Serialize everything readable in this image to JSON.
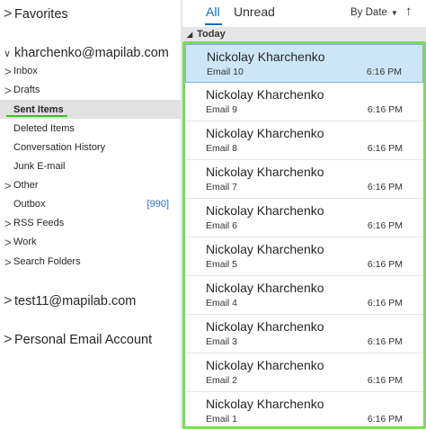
{
  "folders": {
    "favorites_label": "Favorites",
    "accounts": [
      {
        "name": "kharchenko@mapilab.com",
        "items": [
          {
            "label": "Inbox",
            "has_chevron": true
          },
          {
            "label": "Drafts",
            "has_chevron": true
          },
          {
            "label": "Sent Items",
            "has_chevron": false,
            "selected": true
          },
          {
            "label": "Deleted Items",
            "has_chevron": false
          },
          {
            "label": "Conversation History",
            "has_chevron": false
          },
          {
            "label": "Junk E-mail",
            "has_chevron": false
          },
          {
            "label": "Other",
            "has_chevron": true
          },
          {
            "label": "Outbox",
            "has_chevron": false,
            "count": "[990]"
          },
          {
            "label": "RSS Feeds",
            "has_chevron": true
          },
          {
            "label": "Work",
            "has_chevron": true
          },
          {
            "label": "Search Folders",
            "has_chevron": true
          }
        ]
      },
      {
        "name": "test11@mapilab.com"
      },
      {
        "name": "Personal Email Account"
      }
    ]
  },
  "list": {
    "tabs": {
      "all": "All",
      "unread": "Unread"
    },
    "sort_label": "By Date",
    "sort_direction_icon": "↑",
    "group_label": "Today",
    "messages": [
      {
        "sender": "Nickolay Kharchenko",
        "subject": "Email 10",
        "time": "6:16 PM"
      },
      {
        "sender": "Nickolay Kharchenko",
        "subject": "Email 9",
        "time": "6:16 PM"
      },
      {
        "sender": "Nickolay Kharchenko",
        "subject": "Email 8",
        "time": "6:16 PM"
      },
      {
        "sender": "Nickolay Kharchenko",
        "subject": "Email 7",
        "time": "6:16 PM"
      },
      {
        "sender": "Nickolay Kharchenko",
        "subject": "Email 6",
        "time": "6:16 PM"
      },
      {
        "sender": "Nickolay Kharchenko",
        "subject": "Email 5",
        "time": "6:16 PM"
      },
      {
        "sender": "Nickolay Kharchenko",
        "subject": "Email 4",
        "time": "6:16 PM"
      },
      {
        "sender": "Nickolay Kharchenko",
        "subject": "Email 3",
        "time": "6:16 PM"
      },
      {
        "sender": "Nickolay Kharchenko",
        "subject": "Email 2",
        "time": "6:16 PM"
      },
      {
        "sender": "Nickolay Kharchenko",
        "subject": "Email 1",
        "time": "6:16 PM"
      }
    ]
  },
  "colors": {
    "accent": "#0f6cbd",
    "highlight_border": "#7bdc55",
    "selected_message_bg": "#cde6f7",
    "selected_folder_bg": "#e1e1e1"
  }
}
